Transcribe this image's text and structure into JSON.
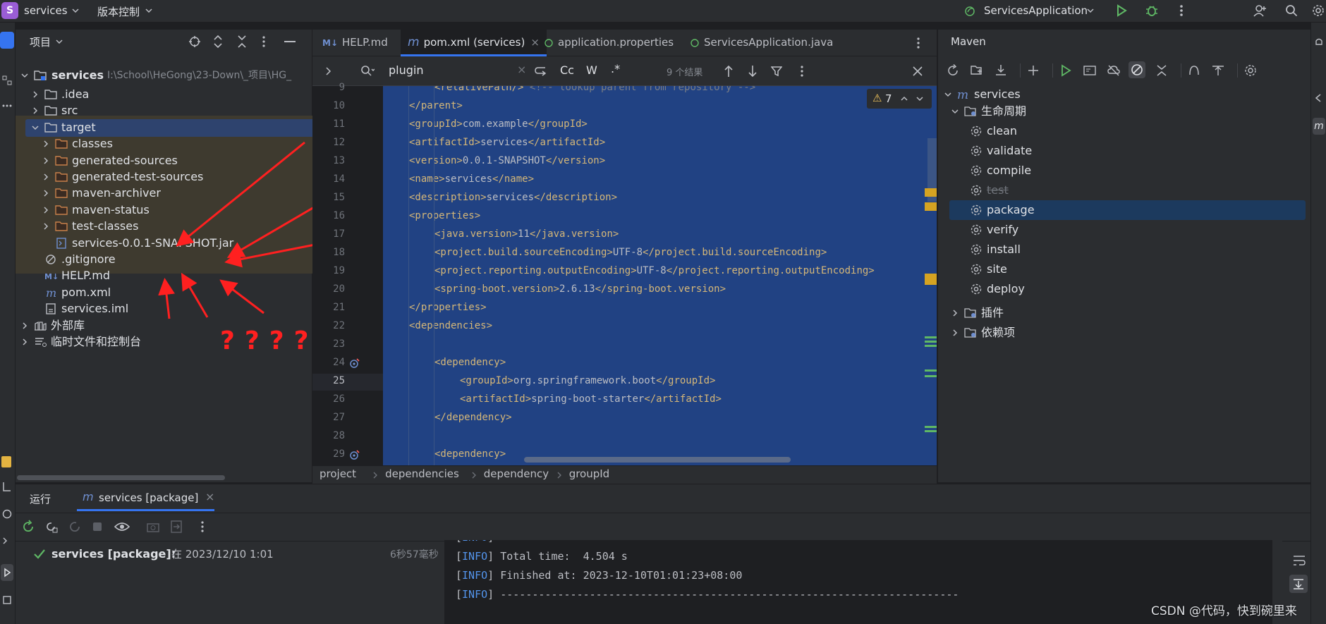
{
  "titlebar": {
    "project_initial": "S",
    "project_name": "services",
    "vcs": "版本控制",
    "run_config": "ServicesApplication"
  },
  "project_panel": {
    "title": "项目",
    "root": {
      "name": "services",
      "path": "I:\\School\\HeGong\\23-Down\\_项目\\HG_"
    },
    "items": [
      {
        "label": ".idea",
        "type": "folder"
      },
      {
        "label": "src",
        "type": "folder"
      },
      {
        "label": "target",
        "type": "folder",
        "selected": true
      },
      {
        "label": "classes",
        "type": "folder-orange"
      },
      {
        "label": "generated-sources",
        "type": "folder-orange"
      },
      {
        "label": "generated-test-sources",
        "type": "folder-orange"
      },
      {
        "label": "maven-archiver",
        "type": "folder-orange"
      },
      {
        "label": "maven-status",
        "type": "folder-orange"
      },
      {
        "label": "test-classes",
        "type": "folder-orange"
      },
      {
        "label": "services-0.0.1-SNAPSHOT.jar",
        "type": "jar"
      },
      {
        "label": ".gitignore",
        "type": "ignore"
      },
      {
        "label": "HELP.md",
        "type": "md"
      },
      {
        "label": "pom.xml",
        "type": "maven"
      },
      {
        "label": "services.iml",
        "type": "iml"
      },
      {
        "label": "外部库",
        "type": "lib"
      },
      {
        "label": "临时文件和控制台",
        "type": "scratch"
      }
    ],
    "annotation_marks": [
      "?",
      "?",
      "?",
      "?",
      "?"
    ]
  },
  "editor": {
    "tabs": [
      {
        "label": "HELP.md",
        "prefix": "M↓"
      },
      {
        "label": "pom.xml (services)",
        "prefix": "m",
        "active": true
      },
      {
        "label": "application.properties",
        "prefix": ""
      },
      {
        "label": "ServicesApplication.java",
        "prefix": ""
      }
    ],
    "search": {
      "query": "plugin",
      "results": "9 个结果",
      "case_label": "Cc",
      "word_label": "W",
      "regex_label": ".*"
    },
    "warnings": "7",
    "lines": [
      {
        "n": "9",
        "indent": 2,
        "parts": [
          [
            "tag",
            "<relativePath/>"
          ],
          [
            "cmt",
            " <!-- lookup parent from repository -->"
          ]
        ]
      },
      {
        "n": "10",
        "indent": 1,
        "parts": [
          [
            "tag",
            "</parent>"
          ]
        ]
      },
      {
        "n": "11",
        "indent": 1,
        "parts": [
          [
            "tag",
            "<groupId>"
          ],
          [
            "txt",
            "com.example"
          ],
          [
            "tag",
            "</groupId>"
          ]
        ]
      },
      {
        "n": "12",
        "indent": 1,
        "parts": [
          [
            "tag",
            "<artifactId>"
          ],
          [
            "txt",
            "services"
          ],
          [
            "tag",
            "</artifactId>"
          ]
        ]
      },
      {
        "n": "13",
        "indent": 1,
        "parts": [
          [
            "tag",
            "<version>"
          ],
          [
            "txt",
            "0.0.1-SNAPSHOT"
          ],
          [
            "tag",
            "</version>"
          ]
        ]
      },
      {
        "n": "14",
        "indent": 1,
        "parts": [
          [
            "tag",
            "<name>"
          ],
          [
            "txt",
            "services"
          ],
          [
            "tag",
            "</name>"
          ]
        ]
      },
      {
        "n": "15",
        "indent": 1,
        "parts": [
          [
            "tag",
            "<description>"
          ],
          [
            "txt",
            "services"
          ],
          [
            "tag",
            "</description>"
          ]
        ]
      },
      {
        "n": "16",
        "indent": 1,
        "parts": [
          [
            "tag",
            "<properties>"
          ]
        ]
      },
      {
        "n": "17",
        "indent": 2,
        "parts": [
          [
            "tag",
            "<java.version>"
          ],
          [
            "txt",
            "11"
          ],
          [
            "tag",
            "</java.version>"
          ]
        ]
      },
      {
        "n": "18",
        "indent": 2,
        "parts": [
          [
            "tag",
            "<project.build.sourceEncoding>"
          ],
          [
            "txt",
            "UTF-8"
          ],
          [
            "tag",
            "</project.build.sourceEncoding>"
          ]
        ]
      },
      {
        "n": "19",
        "indent": 2,
        "parts": [
          [
            "tag",
            "<project.reporting.outputEncoding>"
          ],
          [
            "txt",
            "UTF-8"
          ],
          [
            "tag",
            "</project.reporting.outputEncoding>"
          ]
        ]
      },
      {
        "n": "20",
        "indent": 2,
        "parts": [
          [
            "tag",
            "<spring-boot.version>"
          ],
          [
            "txt",
            "2.6.13"
          ],
          [
            "tag",
            "</spring-boot.version>"
          ]
        ]
      },
      {
        "n": "21",
        "indent": 1,
        "parts": [
          [
            "tag",
            "</properties>"
          ]
        ]
      },
      {
        "n": "22",
        "indent": 1,
        "parts": [
          [
            "tag",
            "<dependencies>"
          ]
        ]
      },
      {
        "n": "23",
        "indent": 0,
        "parts": []
      },
      {
        "n": "24",
        "indent": 2,
        "parts": [
          [
            "tag",
            "<dependency>"
          ]
        ]
      },
      {
        "n": "25",
        "indent": 3,
        "parts": [
          [
            "tag",
            "<groupId>"
          ],
          [
            "txt",
            "org.springframework.boot"
          ],
          [
            "tag",
            "</groupId>"
          ]
        ]
      },
      {
        "n": "26",
        "indent": 3,
        "parts": [
          [
            "tag",
            "<artifactId>"
          ],
          [
            "txt",
            "spring-boot-starter"
          ],
          [
            "tag",
            "</artifactId>"
          ]
        ]
      },
      {
        "n": "27",
        "indent": 2,
        "parts": [
          [
            "tag",
            "</dependency>"
          ]
        ]
      },
      {
        "n": "28",
        "indent": 0,
        "parts": []
      },
      {
        "n": "29",
        "indent": 2,
        "parts": [
          [
            "tag",
            "<dependency>"
          ]
        ]
      }
    ],
    "breadcrumbs": [
      "project",
      "dependencies",
      "dependency",
      "groupId"
    ]
  },
  "maven": {
    "title": "Maven",
    "root": "services",
    "lifecycle_label": "生命周期",
    "goals": [
      "clean",
      "validate",
      "compile",
      "test",
      "package",
      "verify",
      "install",
      "site",
      "deploy"
    ],
    "selected_goal": "package",
    "skipped_goal": "test",
    "plugins_label": "插件",
    "deps_label": "依赖项"
  },
  "run": {
    "tab_run": "运行",
    "tab_active": "services [package]",
    "tree_item": "services [package]:",
    "tree_time": "在 2023/12/10 1:01",
    "duration": "6秒57毫秒",
    "console": [
      {
        "tag": "INFO",
        "text": " ------------------------------------------------------------------------"
      },
      {
        "tag": "INFO",
        "text": " Total time:  4.504 s"
      },
      {
        "tag": "INFO",
        "text": " Finished at: 2023-12-10T01:01:23+08:00"
      },
      {
        "tag": "INFO",
        "text": " ------------------------------------------------------------------------"
      }
    ],
    "watermark": "CSDN @代码，快到碗里来"
  },
  "colors": {
    "accent": "#3574f0",
    "selection": "#214283",
    "arrow": "#ff2020",
    "folder_orange": "#c7804a",
    "run_green": "#5fb865"
  }
}
